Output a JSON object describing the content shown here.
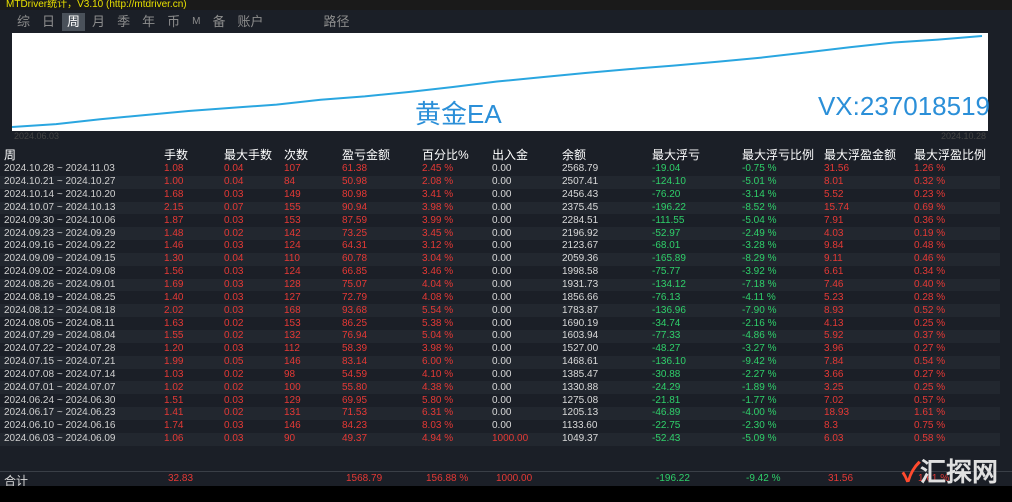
{
  "title": "MTDriver统计，V3.10 (http://mtdriver.cn)",
  "tabs": [
    {
      "label": "综"
    },
    {
      "label": "日"
    },
    {
      "label": "周"
    },
    {
      "label": "月"
    },
    {
      "label": "季"
    },
    {
      "label": "年"
    },
    {
      "label": "币"
    },
    {
      "label": "M"
    },
    {
      "label": "备"
    },
    {
      "label": "账户"
    },
    {
      "label": "路径"
    }
  ],
  "active_tab": "周",
  "chart": {
    "start_date": "2024.06.03",
    "end_date": "2024.10.28",
    "overlay_text": "黄金EA",
    "overlay_vx": "VX:237018519",
    "line_color": "#2aa6e0",
    "balance": [
      1049.37,
      1133.6,
      1205.13,
      1275.08,
      1330.88,
      1385.47,
      1468.61,
      1527.0,
      1603.94,
      1690.19,
      1783.87,
      1856.66,
      1931.73,
      1998.58,
      2059.36,
      2123.67,
      2196.92,
      2284.51,
      2375.45,
      2456.43,
      2507.41,
      2568.79
    ]
  },
  "table": {
    "headers": [
      "周",
      "手数",
      "最大手数",
      "次数",
      "盈亏金额",
      "百分比%",
      "出入金",
      "余额",
      "最大浮亏",
      "最大浮亏比例",
      "最大浮盈金额",
      "最大浮盈比例"
    ],
    "rows": [
      [
        "2024.10.28 ~ 2024.11.03",
        "1.08",
        "0.04",
        "107",
        "61.38",
        "2.45 %",
        "0.00",
        "2568.79",
        "-19.04",
        "-0.75 %",
        "31.56",
        "1.26 %"
      ],
      [
        "2024.10.21 ~ 2024.10.27",
        "1.00",
        "0.04",
        "84",
        "50.98",
        "2.08 %",
        "0.00",
        "2507.41",
        "-124.10",
        "-5.01 %",
        "8.01",
        "0.32 %"
      ],
      [
        "2024.10.14 ~ 2024.10.20",
        "1.68",
        "0.03",
        "149",
        "80.98",
        "3.41 %",
        "0.00",
        "2456.43",
        "-76.20",
        "-3.14 %",
        "5.52",
        "0.23 %"
      ],
      [
        "2024.10.07 ~ 2024.10.13",
        "2.15",
        "0.07",
        "155",
        "90.94",
        "3.98 %",
        "0.00",
        "2375.45",
        "-196.22",
        "-8.52 %",
        "15.74",
        "0.69 %"
      ],
      [
        "2024.09.30 ~ 2024.10.06",
        "1.87",
        "0.03",
        "153",
        "87.59",
        "3.99 %",
        "0.00",
        "2284.51",
        "-111.55",
        "-5.04 %",
        "7.91",
        "0.36 %"
      ],
      [
        "2024.09.23 ~ 2024.09.29",
        "1.48",
        "0.02",
        "142",
        "73.25",
        "3.45 %",
        "0.00",
        "2196.92",
        "-52.97",
        "-2.49 %",
        "4.03",
        "0.19 %"
      ],
      [
        "2024.09.16 ~ 2024.09.22",
        "1.46",
        "0.03",
        "124",
        "64.31",
        "3.12 %",
        "0.00",
        "2123.67",
        "-68.01",
        "-3.28 %",
        "9.84",
        "0.48 %"
      ],
      [
        "2024.09.09 ~ 2024.09.15",
        "1.30",
        "0.04",
        "110",
        "60.78",
        "3.04 %",
        "0.00",
        "2059.36",
        "-165.89",
        "-8.29 %",
        "9.11",
        "0.46 %"
      ],
      [
        "2024.09.02 ~ 2024.09.08",
        "1.56",
        "0.03",
        "124",
        "66.85",
        "3.46 %",
        "0.00",
        "1998.58",
        "-75.77",
        "-3.92 %",
        "6.61",
        "0.34 %"
      ],
      [
        "2024.08.26 ~ 2024.09.01",
        "1.69",
        "0.03",
        "128",
        "75.07",
        "4.04 %",
        "0.00",
        "1931.73",
        "-134.12",
        "-7.18 %",
        "7.46",
        "0.40 %"
      ],
      [
        "2024.08.19 ~ 2024.08.25",
        "1.40",
        "0.03",
        "127",
        "72.79",
        "4.08 %",
        "0.00",
        "1856.66",
        "-76.13",
        "-4.11 %",
        "5.23",
        "0.28 %"
      ],
      [
        "2024.08.12 ~ 2024.08.18",
        "2.02",
        "0.03",
        "168",
        "93.68",
        "5.54 %",
        "0.00",
        "1783.87",
        "-136.96",
        "-7.90 %",
        "8.93",
        "0.52 %"
      ],
      [
        "2024.08.05 ~ 2024.08.11",
        "1.63",
        "0.02",
        "153",
        "86.25",
        "5.38 %",
        "0.00",
        "1690.19",
        "-34.74",
        "-2.16 %",
        "4.13",
        "0.25 %"
      ],
      [
        "2024.07.29 ~ 2024.08.04",
        "1.55",
        "0.02",
        "132",
        "76.94",
        "5.04 %",
        "0.00",
        "1603.94",
        "-77.33",
        "-4.86 %",
        "5.92",
        "0.37 %"
      ],
      [
        "2024.07.22 ~ 2024.07.28",
        "1.20",
        "0.03",
        "112",
        "58.39",
        "3.98 %",
        "0.00",
        "1527.00",
        "-48.27",
        "-3.27 %",
        "3.96",
        "0.27 %"
      ],
      [
        "2024.07.15 ~ 2024.07.21",
        "1.99",
        "0.05",
        "146",
        "83.14",
        "6.00 %",
        "0.00",
        "1468.61",
        "-136.10",
        "-9.42 %",
        "7.84",
        "0.54 %"
      ],
      [
        "2024.07.08 ~ 2024.07.14",
        "1.03",
        "0.02",
        "98",
        "54.59",
        "4.10 %",
        "0.00",
        "1385.47",
        "-30.88",
        "-2.27 %",
        "3.66",
        "0.27 %"
      ],
      [
        "2024.07.01 ~ 2024.07.07",
        "1.02",
        "0.02",
        "100",
        "55.80",
        "4.38 %",
        "0.00",
        "1330.88",
        "-24.29",
        "-1.89 %",
        "3.25",
        "0.25 %"
      ],
      [
        "2024.06.24 ~ 2024.06.30",
        "1.51",
        "0.03",
        "129",
        "69.95",
        "5.80 %",
        "0.00",
        "1275.08",
        "-21.81",
        "-1.77 %",
        "7.02",
        "0.57 %"
      ],
      [
        "2024.06.17 ~ 2024.06.23",
        "1.41",
        "0.02",
        "131",
        "71.53",
        "6.31 %",
        "0.00",
        "1205.13",
        "-46.89",
        "-4.00 %",
        "18.93",
        "1.61 %"
      ],
      [
        "2024.06.10 ~ 2024.06.16",
        "1.74",
        "0.03",
        "146",
        "84.23",
        "8.03 %",
        "0.00",
        "1133.60",
        "-22.75",
        "-2.30 %",
        "8.3",
        "0.75 %"
      ],
      [
        "2024.06.03 ~ 2024.06.09",
        "1.06",
        "0.03",
        "90",
        "49.37",
        "4.94 %",
        "1000.00",
        "1049.37",
        "-52.43",
        "-5.09 %",
        "6.03",
        "0.58 %"
      ]
    ]
  },
  "total": {
    "label": "合计",
    "lots": "32.83",
    "profit": "1568.79",
    "percent": "156.88 %",
    "deposit": "1000.00",
    "max_float_loss": "-196.22",
    "max_float_loss_pct": "-9.42 %",
    "max_float_profit": "31.56",
    "max_float_profit_pct": "1.61 %"
  },
  "watermark": "汇探网",
  "colors": {
    "profit": "#e53935",
    "loss": "#2fd06a",
    "background": "#1b1f27",
    "chart_bg": "#ffffff"
  }
}
